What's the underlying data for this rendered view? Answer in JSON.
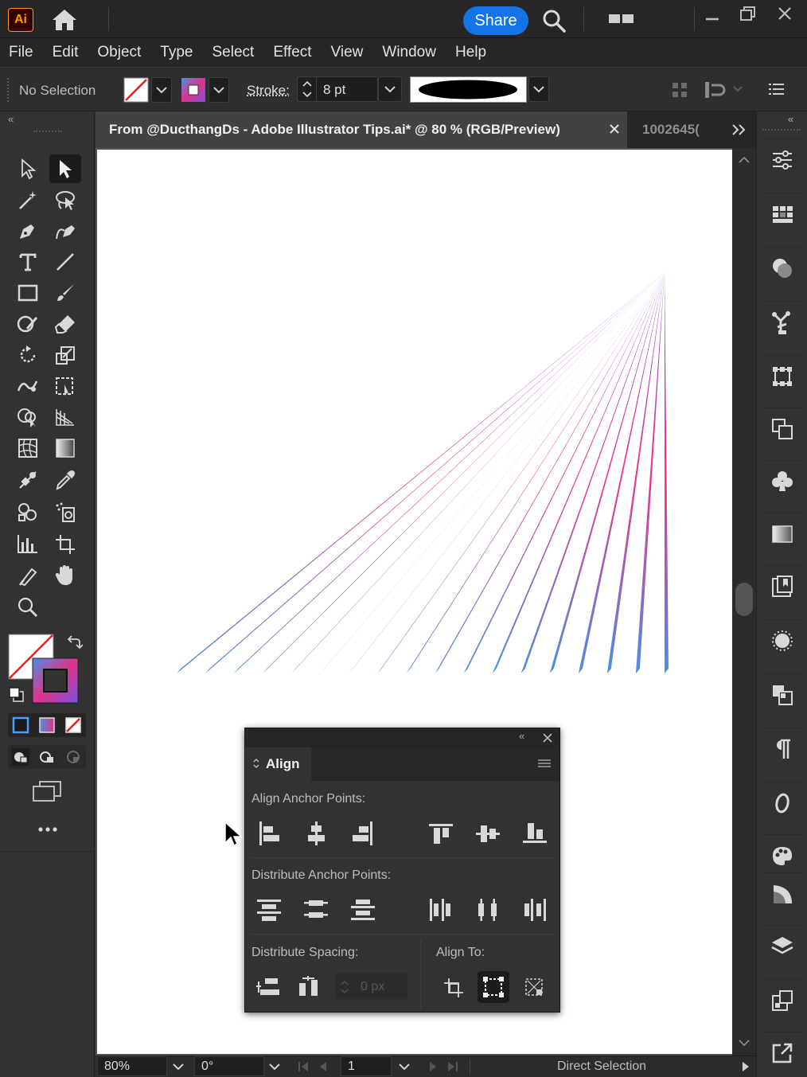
{
  "app": {
    "logo_text": "Ai"
  },
  "titlebar": {
    "share_label": "Share"
  },
  "menu": [
    "File",
    "Edit",
    "Object",
    "Type",
    "Select",
    "Effect",
    "View",
    "Window",
    "Help"
  ],
  "control": {
    "selection_label": "No Selection",
    "stroke_label": "Stroke:",
    "stroke_value": "8 pt"
  },
  "document": {
    "active_tab_title": "From @DucthangDs - Adobe Illustrator Tips.ai* @ 80 % (RGB/Preview)",
    "inactive_tab_title": "1002645(",
    "artwork": {
      "apex": "top-right",
      "line_count": 18,
      "gradient": [
        "#4a90e2",
        "#f0338a",
        "#7b52e0"
      ]
    }
  },
  "status": {
    "zoom": "80%",
    "rotation": "0°",
    "artboard_number": "1",
    "current_tool": "Direct Selection"
  },
  "align_panel": {
    "tab_label": "Align",
    "align_anchor_label": "Align Anchor Points:",
    "distribute_anchor_label": "Distribute Anchor Points:",
    "distribute_spacing_label": "Distribute Spacing:",
    "align_to_label": "Align To:",
    "spacing_value": "0 px"
  },
  "colors": {
    "accent": "#1473e6",
    "logo_orange": "#ff9a00",
    "panel_bg": "#323232",
    "artboard": "#ffffff"
  }
}
